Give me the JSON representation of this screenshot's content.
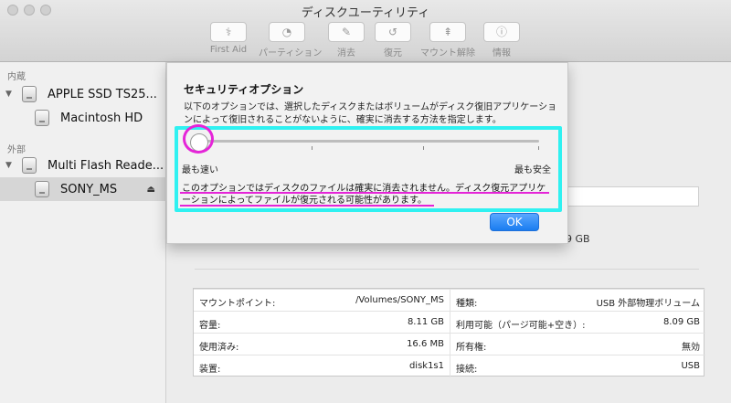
{
  "window": {
    "title": "ディスクユーティリティ"
  },
  "toolbar": {
    "items": [
      {
        "label": "First Aid",
        "icon": "first-aid-icon"
      },
      {
        "label": "パーティション",
        "icon": "partition-icon"
      },
      {
        "label": "消去",
        "icon": "erase-icon"
      },
      {
        "label": "復元",
        "icon": "restore-icon"
      },
      {
        "label": "マウント解除",
        "icon": "unmount-icon"
      },
      {
        "label": "情報",
        "icon": "info-icon"
      }
    ]
  },
  "sidebar": {
    "internal_label": "内蔵",
    "external_label": "外部",
    "items": [
      {
        "label": "APPLE SSD TS25..."
      },
      {
        "label": "Macintosh HD"
      },
      {
        "label": "Multi Flash Reade..."
      },
      {
        "label": "SONY_MS",
        "eject": "⏏"
      }
    ]
  },
  "sheet": {
    "title": "セキュリティオプション",
    "description": "以下のオプションでは、選択したディスクまたはボリュームがディスク復旧アプリケーションによって復旧されることがないように、確実に消去する方法を指定します。",
    "slider_min_label": "最も速い",
    "slider_max_label": "最も安全",
    "slider_value": 0,
    "note_line1": "このオプションではディスクのファイルは確実に消去されません。ディスク復元アプリケ",
    "note_line2": "ーションによってファイルが復元される可能性があります。",
    "ok_label": "OK"
  },
  "main": {
    "size_fragment": "9 GB"
  },
  "info": {
    "rows": [
      {
        "k1": "マウントポイント:",
        "v1": "/Volumes/SONY_MS",
        "k2": "種類:",
        "v2": "USB 外部物理ボリューム"
      },
      {
        "k1": "容量:",
        "v1": "8.11 GB",
        "k2": "利用可能（パージ可能+空き）:",
        "v2": "8.09 GB"
      },
      {
        "k1": "使用済み:",
        "v1": "16.6 MB",
        "k2": "所有権:",
        "v2": "無効"
      },
      {
        "k1": "装置:",
        "v1": "disk1s1",
        "k2": "接続:",
        "v2": "USB"
      }
    ]
  },
  "colors": {
    "highlight_cyan": "#2ff1f1",
    "highlight_magenta": "#e524d8",
    "accent_blue": "#1a7cf0"
  }
}
